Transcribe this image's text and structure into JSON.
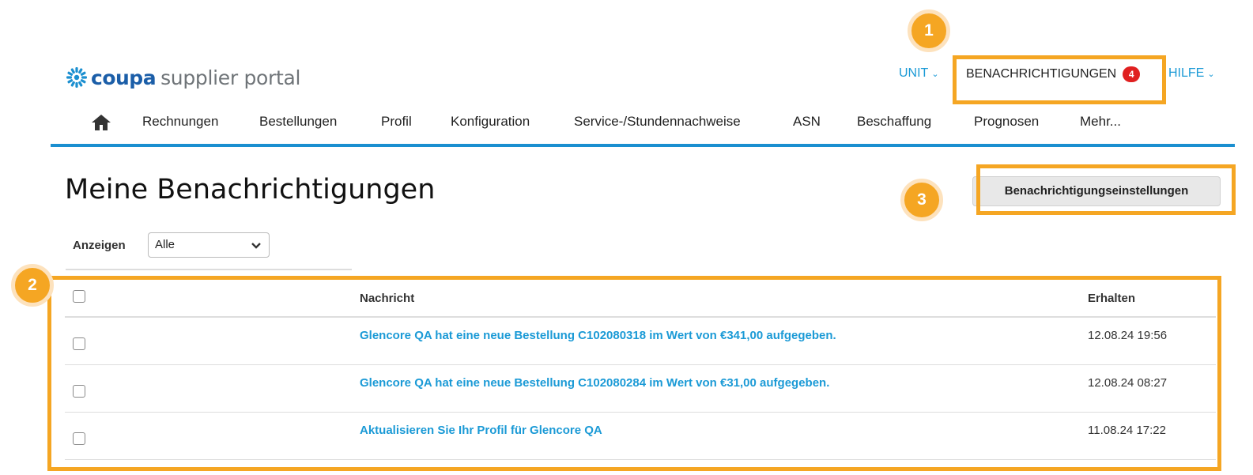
{
  "logo": {
    "brand": "coupa",
    "tagline": "supplier portal"
  },
  "header": {
    "unit_label": "UNIT",
    "notifications_label": "BENACHRICHTIGUNGEN",
    "notifications_count": "4",
    "help_label": "HILFE"
  },
  "nav": {
    "items": [
      "Rechnungen",
      "Bestellungen",
      "Profil",
      "Konfiguration",
      "Service-/Stundennachweise",
      "ASN",
      "Beschaffung",
      "Prognosen",
      "Mehr..."
    ]
  },
  "page": {
    "title": "Meine Benachrichtigungen",
    "settings_button": "Benachrichtigungseinstellungen",
    "filter_label": "Anzeigen",
    "filter_value": "Alle"
  },
  "table": {
    "columns": [
      "Nachricht",
      "Erhalten"
    ],
    "rows": [
      {
        "message": "Glencore QA hat eine neue Bestellung C102080318 im Wert von €341,00 aufgegeben.",
        "received": "12.08.24 19:56"
      },
      {
        "message": "Glencore QA hat eine neue Bestellung C102080284 im Wert von €31,00 aufgegeben.",
        "received": "12.08.24 08:27"
      },
      {
        "message": "Aktualisieren Sie Ihr Profil für Glencore QA",
        "received": "11.08.24 17:22"
      }
    ]
  },
  "annotations": {
    "markers": [
      "1",
      "2",
      "3"
    ],
    "color": "#f5a623"
  },
  "colors": {
    "link": "#1b9ad6",
    "nav_underline": "#1b8fd0",
    "badge": "#e02020"
  }
}
